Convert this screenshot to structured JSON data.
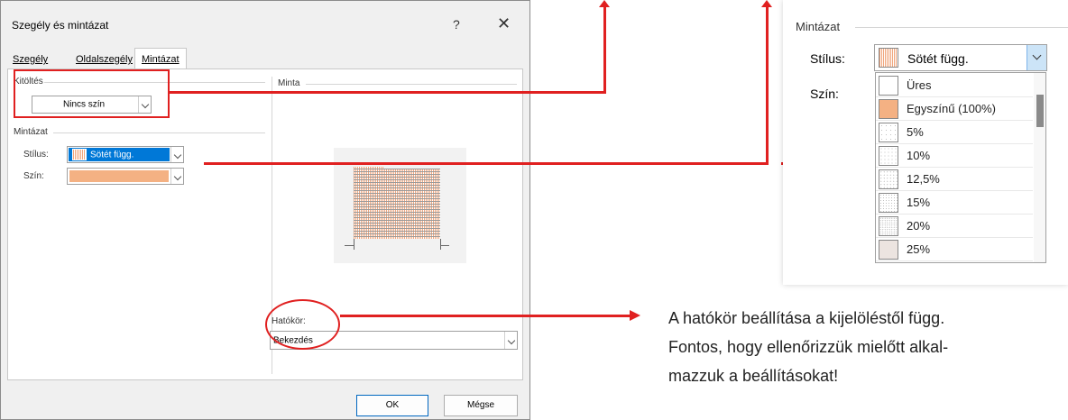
{
  "dialog": {
    "title": "Szegély és mintázat",
    "help": "?",
    "close": "✕",
    "tabs": [
      {
        "label": "Szegély",
        "active": false
      },
      {
        "label": "Oldalszegély",
        "active": false
      },
      {
        "label": "Mintázat",
        "active": true
      }
    ],
    "fill": {
      "group_label": "Kitöltés",
      "value": "Nincs szín"
    },
    "pattern": {
      "group_label": "Mintázat",
      "style_label": "Stílus:",
      "style_value": "Sötét függ.",
      "color_label": "Szín:",
      "color_value": "#f4b183"
    },
    "preview": {
      "group_label": "Minta"
    },
    "scope": {
      "label": "Hatókör:",
      "value": "Bekezdés"
    },
    "ok_label": "OK",
    "cancel_label": "Mégse"
  },
  "flyout": {
    "group_label": "Mintázat",
    "style_label": "Stílus:",
    "style_value": "Sötét függ.",
    "color_label": "Szín:",
    "items": [
      "Üres",
      "Egyszínű (100%)",
      "5%",
      "10%",
      "12,5%",
      "15%",
      "20%",
      "25%"
    ]
  },
  "note": {
    "lines": [
      "A hatókör beállítása a kijelöléstől függ.",
      "Fontos, hogy ellenőrizzük mielőtt alkal-",
      "mazzuk a beállításokat!"
    ]
  },
  "colors": {
    "accent_red": "#e02020",
    "pattern_orange": "#f0a57c",
    "selection_blue": "#0078d7"
  }
}
